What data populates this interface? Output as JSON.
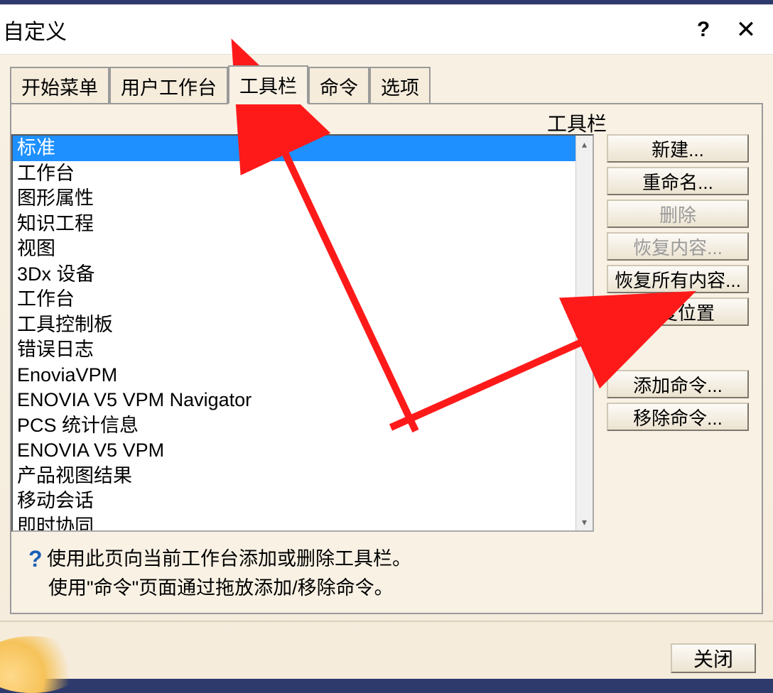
{
  "titlebar": {
    "title": "自定义",
    "help": "?",
    "close": "✕"
  },
  "tabs": [
    {
      "label": "开始菜单"
    },
    {
      "label": "用户工作台"
    },
    {
      "label": "工具栏"
    },
    {
      "label": "命令"
    },
    {
      "label": "选项"
    }
  ],
  "active_tab_index": 2,
  "panel": {
    "label": "工具栏"
  },
  "list": {
    "items": [
      "标准",
      "工作台",
      "图形属性",
      "知识工程",
      "视图",
      "3Dx 设备",
      "工作台",
      "工具控制板",
      "错误日志",
      "EnoviaVPM",
      "ENOVIA V5 VPM Navigator",
      "PCS 统计信息",
      "ENOVIA V5 VPM",
      "产品视图结果",
      "移动会话",
      "即时协同"
    ],
    "selected_index": 0
  },
  "buttons": {
    "new": "新建...",
    "rename": "重命名...",
    "delete": "删除",
    "restore_content": "恢复内容...",
    "restore_all": "恢复所有内容...",
    "restore_position": "恢复位置",
    "add_cmd": "添加命令...",
    "remove_cmd": "移除命令..."
  },
  "hint": {
    "line1": "使用此页向当前工作台添加或删除工具栏。",
    "line2": "使用\"命令\"页面通过拖放添加/移除命令。"
  },
  "close_label": "关闭"
}
